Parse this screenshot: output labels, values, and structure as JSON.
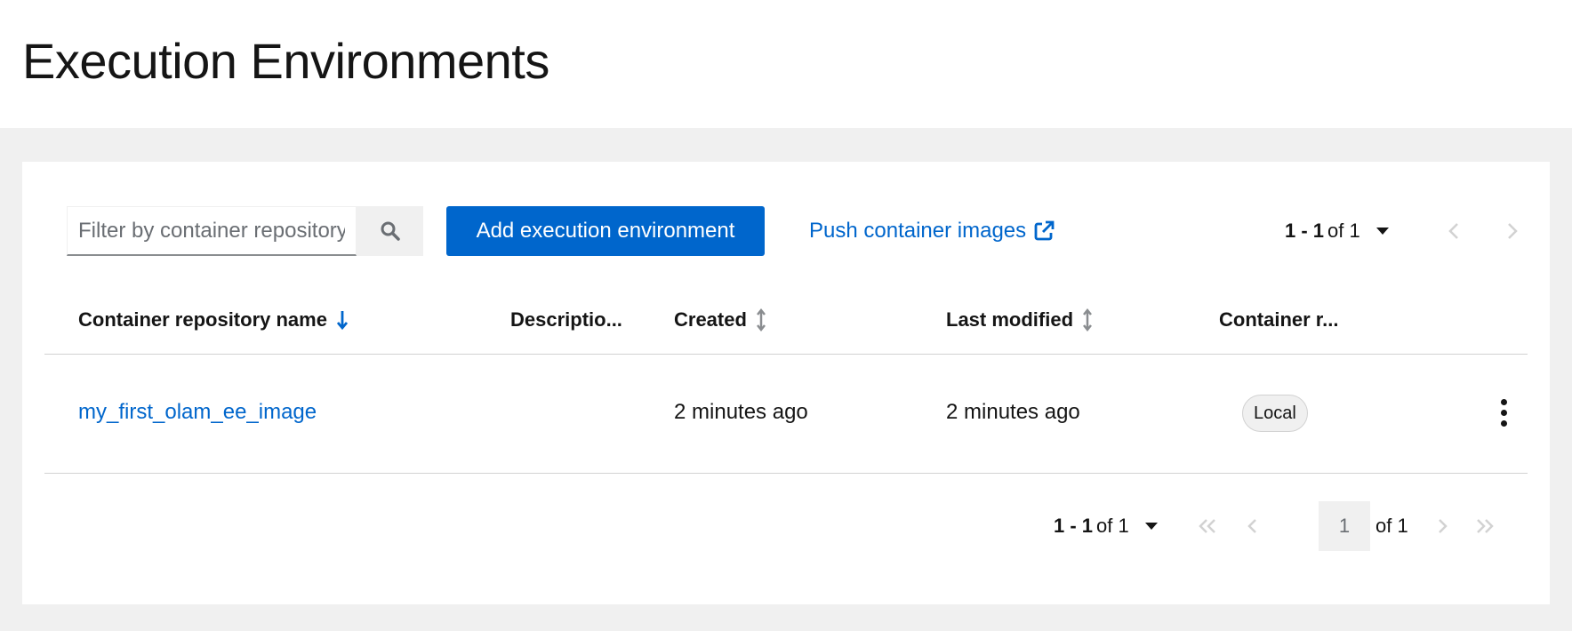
{
  "page": {
    "title": "Execution Environments"
  },
  "toolbar": {
    "search_placeholder": "Filter by container repository name",
    "add_label": "Add execution environment",
    "push_label": "Push container images"
  },
  "pagination_top": {
    "range": "1 - 1",
    "of_total": "of 1"
  },
  "table": {
    "columns": [
      {
        "label": "Container repository name",
        "sort": "descending"
      },
      {
        "label": "Descriptio..."
      },
      {
        "label": "Created",
        "sort": "sortable"
      },
      {
        "label": "Last modified",
        "sort": "sortable"
      },
      {
        "label": "Container r..."
      }
    ],
    "rows": [
      {
        "name": "my_first_olam_ee_image",
        "description": "",
        "created": "2 minutes ago",
        "last_modified": "2 minutes ago",
        "registry": "Local"
      }
    ]
  },
  "pagination_bottom": {
    "range": "1 - 1",
    "of_total": "of 1",
    "current_page": "1",
    "of_pages": "of 1"
  },
  "colors": {
    "primary": "#0066cc",
    "link": "#0066cc",
    "background": "#f0f0f0"
  }
}
